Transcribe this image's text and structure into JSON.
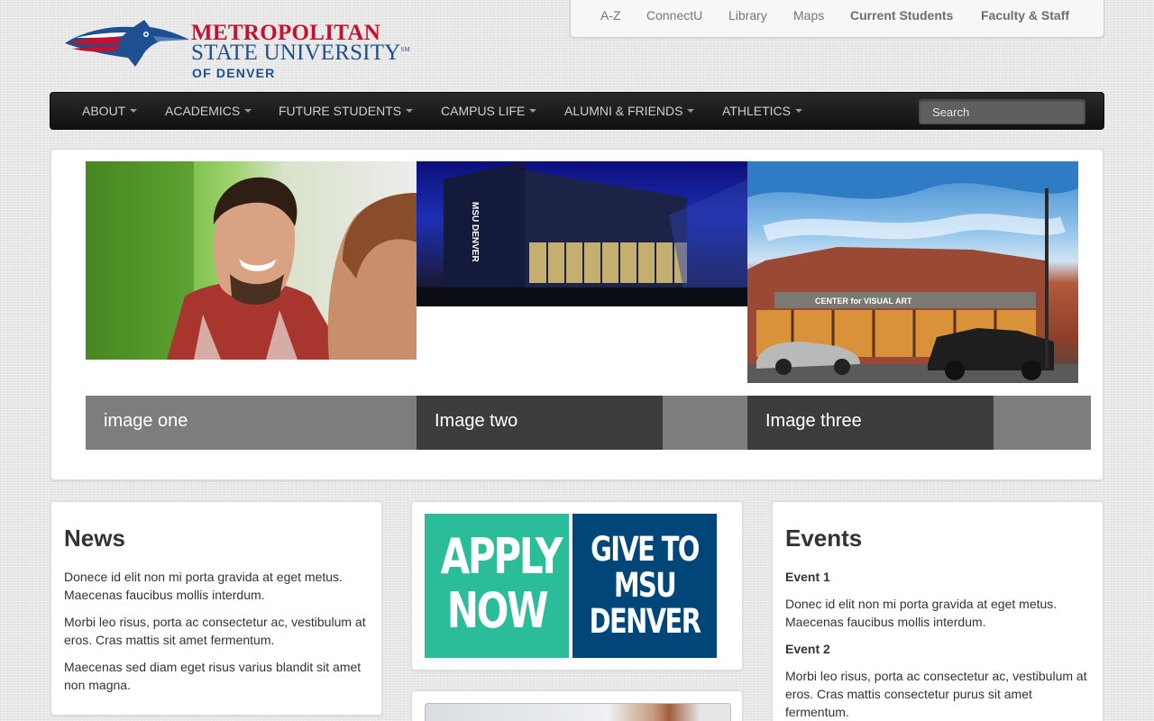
{
  "header": {
    "logo": {
      "line1": "METROPOLITAN",
      "line2": "STATE UNIVERSITY",
      "mark": "SM",
      "line3": "OF DENVER"
    },
    "utility_links": [
      "A-Z",
      "ConnectU",
      "Library",
      "Maps",
      "Current Students",
      "Faculty & Staff"
    ]
  },
  "nav": {
    "items": [
      "ABOUT",
      "ACADEMICS",
      "FUTURE STUDENTS",
      "CAMPUS LIFE",
      "ALUMNI & FRIENDS",
      "ATHLETICS"
    ],
    "search_placeholder": "Search"
  },
  "carousel": {
    "slides": [
      {
        "caption": "image one",
        "image": "student-smiling-photo"
      },
      {
        "caption": "Image two",
        "image": "msu-building-night-photo"
      },
      {
        "caption": "Image three",
        "image": "center-for-visual-art-photo"
      }
    ],
    "building_sign": "CENTER for VISUAL ART",
    "building_msu_sign": "MSU DENVER"
  },
  "news": {
    "title": "News",
    "paragraphs": [
      "Donece id elit non mi porta gravida at eget metus. Maecenas faucibus mollis interdum.",
      "Morbi leo risus, porta ac consectetur ac, vestibulum at eros. Cras mattis sit amet fermentum.",
      "Maecenas sed diam eget risus varius blandit sit amet non magna."
    ]
  },
  "promo": {
    "apply_line1": "APPLY",
    "apply_line2": "NOW",
    "give_line1": "GIVE TO",
    "give_line2": "MSU",
    "give_line3": "DENVER"
  },
  "events": {
    "title": "Events",
    "items": [
      {
        "title": "Event 1",
        "text": "Donec id elit non mi porta gravida at eget metus. Maecenas faucibus mollis interdum."
      },
      {
        "title": "Event 2",
        "text": "Morbi leo risus, porta ac consectetur ac, vestibulum at eros. Cras mattis consectetur purus sit amet fermentum."
      }
    ]
  },
  "colors": {
    "brand_red": "#c8102e",
    "brand_blue": "#1d4f91",
    "apply_green": "#2bbc9a",
    "give_blue": "#004679",
    "navbar": "#1a1a1a"
  }
}
